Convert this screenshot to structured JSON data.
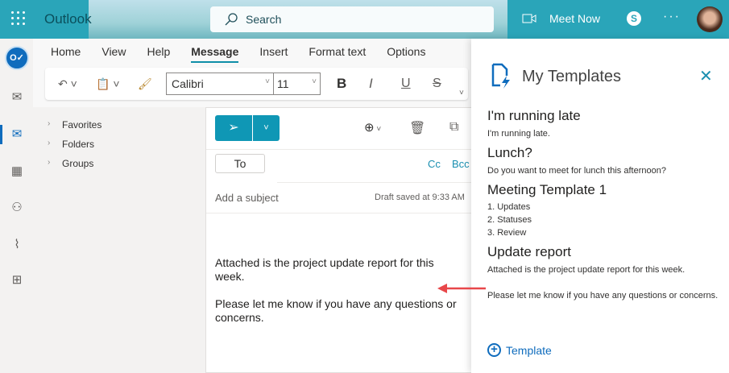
{
  "header": {
    "app_name": "Outlook",
    "search_placeholder": "Search",
    "meet_now": "Meet Now",
    "skype": "S",
    "more": "···"
  },
  "ribbon": {
    "tabs": [
      "Home",
      "View",
      "Help",
      "Message",
      "Insert",
      "Format text",
      "Options"
    ],
    "active_tab": "Message",
    "font": "Calibri",
    "font_size": "11"
  },
  "folders": [
    "Favorites",
    "Folders",
    "Groups"
  ],
  "compose": {
    "to_label": "To",
    "cc": "Cc",
    "bcc": "Bcc",
    "subject_placeholder": "Add a subject",
    "draft_status": "Draft saved at 9:33 AM",
    "body": [
      "Attached is the project update report for this week.",
      "Please let me know if you have any questions or concerns."
    ]
  },
  "templates_panel": {
    "title": "My Templates",
    "templates": [
      {
        "name": "I'm running late",
        "text": [
          "I'm running late."
        ]
      },
      {
        "name": "Lunch?",
        "text": [
          "Do you want to meet for lunch this afternoon?"
        ]
      },
      {
        "name": "Meeting Template 1",
        "text": [
          "1. Updates",
          "2. Statuses",
          "3. Review"
        ]
      },
      {
        "name": "Update report",
        "text": [
          "Attached is the project update report for this week.",
          "",
          "Please let me know if you have any questions or concerns."
        ]
      }
    ],
    "add_label": "Template"
  },
  "colors": {
    "accent": "#0f97b5",
    "annotation_arrow": "#e8474a"
  }
}
